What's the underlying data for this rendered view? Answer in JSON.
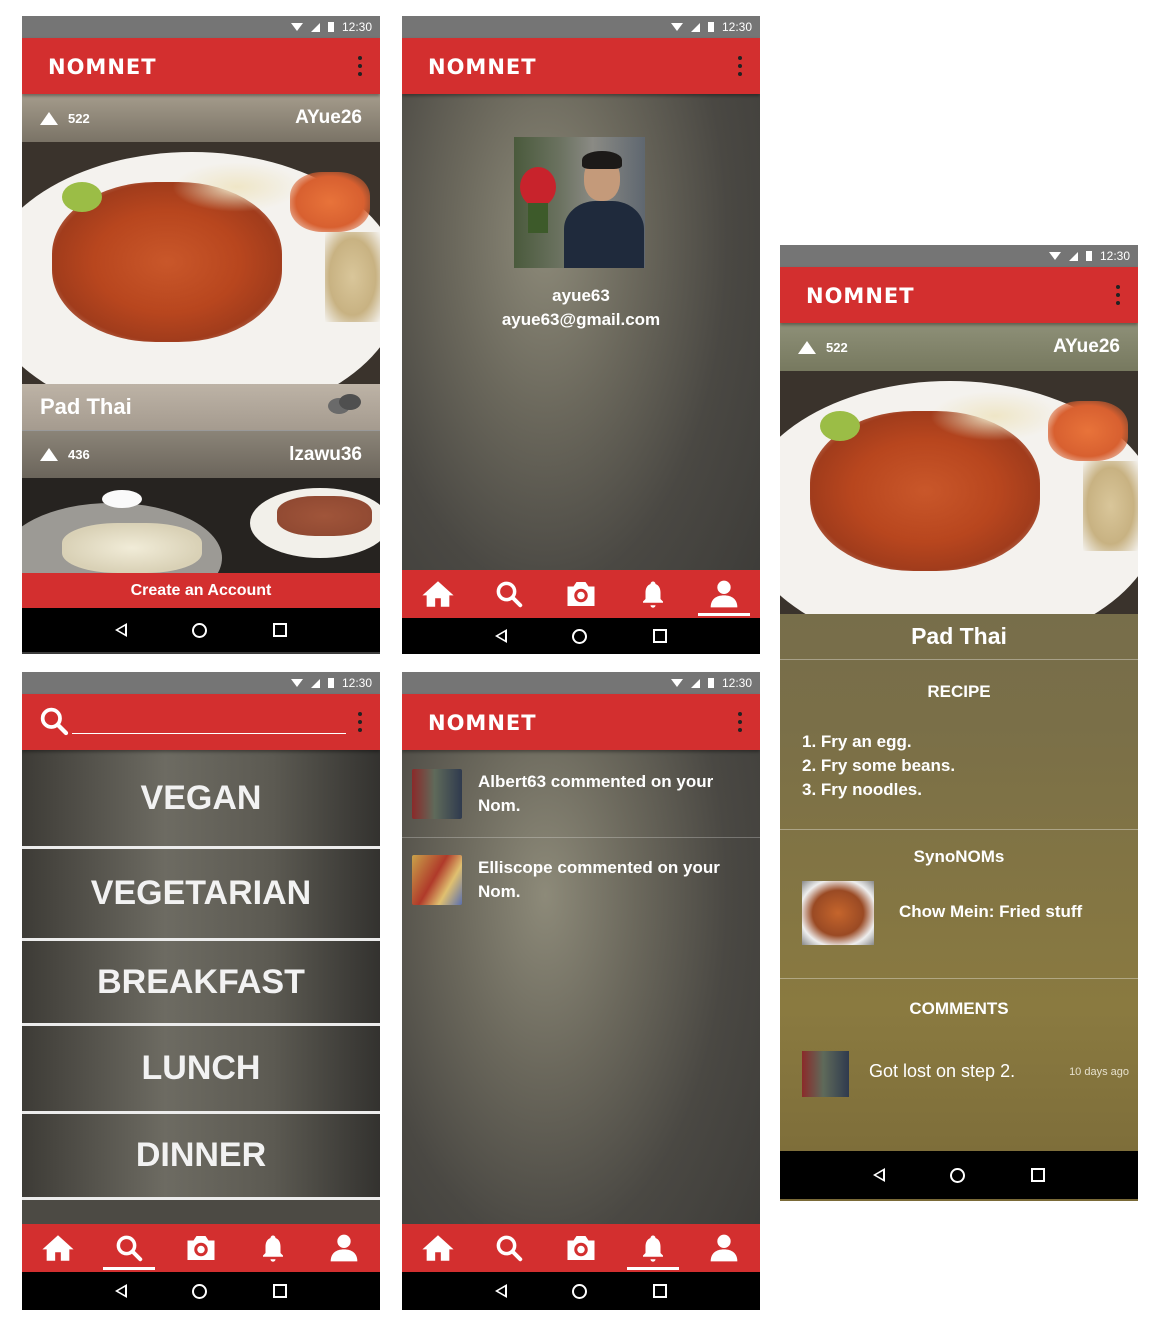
{
  "status": {
    "time": "12:30"
  },
  "app": {
    "logo": "NOMNET"
  },
  "feed": {
    "posts": [
      {
        "votes": "522",
        "user": "AYue26",
        "title": "Pad Thai"
      },
      {
        "votes": "436",
        "user": "lzawu36"
      }
    ],
    "create_account": "Create an Account"
  },
  "profile": {
    "username": "ayue63",
    "email": "ayue63@gmail.com"
  },
  "search": {
    "placeholder": "",
    "categories": [
      "VEGAN",
      "VEGETARIAN",
      "BREAKFAST",
      "LUNCH",
      "DINNER"
    ]
  },
  "notifications": [
    {
      "text": "Albert63 commented on your Nom."
    },
    {
      "text": "Elliscope commented on your Nom."
    }
  ],
  "detail": {
    "votes": "522",
    "user": "AYue26",
    "title": "Pad Thai",
    "recipe_title": "RECIPE",
    "steps": [
      "1. Fry an egg.",
      "2. Fry some beans.",
      "3. Fry noodles."
    ],
    "synonoms_title": "SynoNOMs",
    "synonom": "Chow Mein: Fried stuff",
    "comments_title": "COMMENTS",
    "comment": {
      "text": "Got lost on step 2.",
      "time": "10 days ago"
    }
  },
  "icons": {
    "home": "home-icon",
    "search": "search-icon",
    "camera": "camera-icon",
    "bell": "bell-icon",
    "person": "person-icon",
    "chat": "chat-icon"
  },
  "colors": {
    "primary": "#d32f2f",
    "status": "#757575"
  }
}
